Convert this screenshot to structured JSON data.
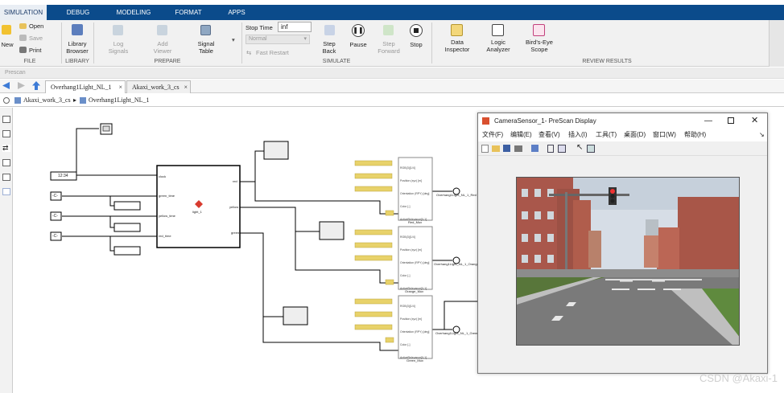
{
  "main_tabs": [
    "SIMULATION",
    "DEBUG",
    "MODELING",
    "FORMAT",
    "APPS"
  ],
  "ribbon": {
    "file": {
      "new": "New",
      "open": "Open",
      "save": "Save",
      "print": "Print",
      "label": "FILE"
    },
    "library": {
      "browser": "Library\nBrowser",
      "label": "LIBRARY"
    },
    "prepare": {
      "log_signals": "Log\nSignals",
      "add_viewer": "Add\nViewer",
      "signal_table": "Signal\nTable",
      "label": "PREPARE"
    },
    "simulate": {
      "stop_time_label": "Stop Time",
      "stop_time_value": "inf",
      "mode": "Normal",
      "fast_restart": "Fast Restart",
      "step_back": "Step\nBack",
      "pause": "Pause",
      "step_forward": "Step\nForward",
      "stop": "Stop",
      "label": "SIMULATE"
    },
    "review": {
      "data_inspector": "Data\nInspector",
      "logic_analyzer": "Logic\nAnalyzer",
      "birds_eye": "Bird's-Eye\nScope",
      "label": "REVIEW RESULTS"
    }
  },
  "prescan_label": "Prescan",
  "doc_tabs": [
    "Overhang1Light_NL_1",
    "Akaxi_work_3_cs"
  ],
  "breadcrumb": {
    "root": "Akaxi_work_3_cs",
    "child": "Overhang1Light_NL_1"
  },
  "diagram": {
    "clock_value": "12:34",
    "const_values": [
      "-C-",
      "-C-",
      "-C-"
    ],
    "subsystem": {
      "ports_in": [
        "clock",
        "green_time",
        "yellow_time",
        "red_time"
      ],
      "ports_out": [
        "red",
        "yellow",
        "green"
      ],
      "name": "light_1"
    },
    "light_blocks": [
      {
        "name": "Red_Mux",
        "bus_label": "Overhang1Light_NL_1_Red"
      },
      {
        "name": "Orange_Mux",
        "bus_label": "Overhang1Light_NL_1_Orange"
      },
      {
        "name": "Green_Mux",
        "bus_label": "Overhang1Light_NL_1_Green"
      }
    ],
    "light_ports": [
      "RGB(3)[1/4]",
      "Position (xyz) [m]",
      "Orientation (RPY) [deg]",
      "Color [-]",
      "ActiveRelevance[0-1]"
    ]
  },
  "camera_window": {
    "title": "CameraSensor_1- PreScan Display",
    "menu": [
      "文件(F)",
      "编辑(E)",
      "查看(V)",
      "插入(I)",
      "工具(T)",
      "桌面(D)",
      "窗口(W)",
      "帮助(H)"
    ]
  },
  "watermark": "CSDN @Akaxi-1",
  "colors": {
    "tabbar": "#0b4b8b",
    "accent_block": "#e8d26a"
  }
}
